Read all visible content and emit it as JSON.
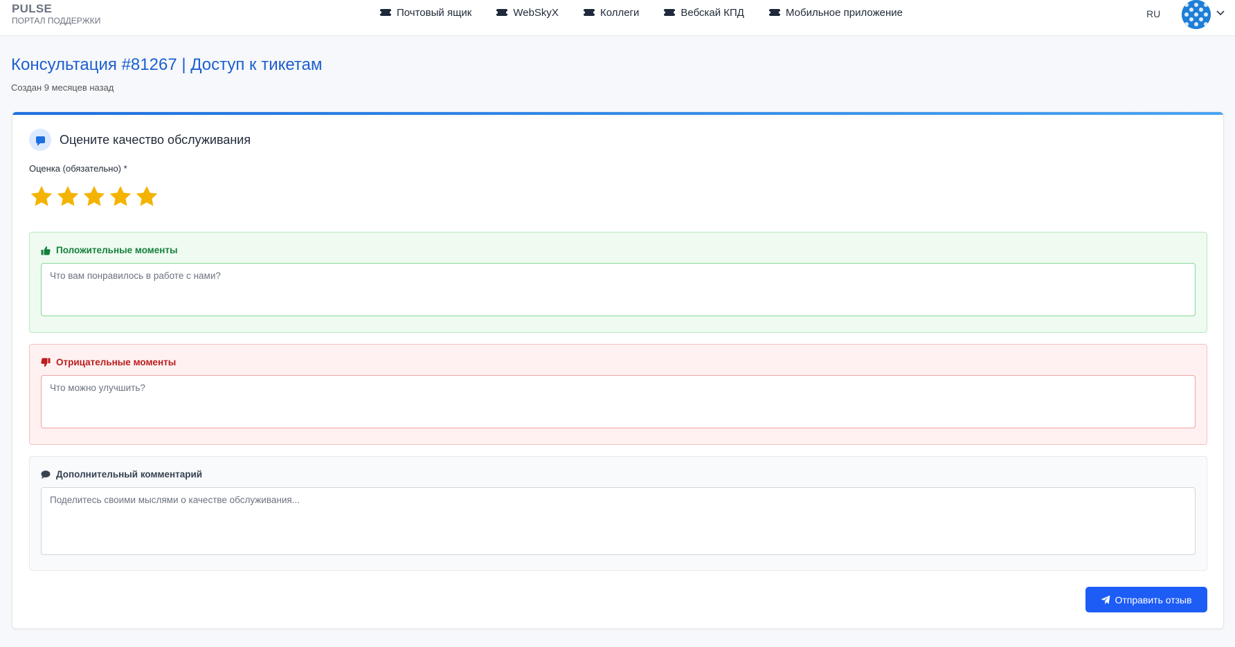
{
  "header": {
    "brand_name": "PULSE",
    "brand_sub": "ПОРТАЛ ПОДДЕРЖКИ",
    "nav": [
      {
        "label": "Почтовый ящик",
        "icon": "ticket-icon"
      },
      {
        "label": "WebSkyX",
        "icon": "ticket-icon"
      },
      {
        "label": "Коллеги",
        "icon": "ticket-icon"
      },
      {
        "label": "Вебскай КПД",
        "icon": "ticket-icon"
      },
      {
        "label": "Мобильное приложение",
        "icon": "ticket-icon"
      }
    ],
    "language": "RU",
    "avatar_icon": "avatar-pattern",
    "menu_icon": "chevron-down-icon"
  },
  "page": {
    "title": "Консультация #81267 | Доступ к тикетам",
    "subtitle": "Создан 9 месяцев назад"
  },
  "feedback": {
    "title": "Оцените качество обслуживания",
    "title_icon": "chat-bubble-icon",
    "rating_label": "Оценка (обязательно) *",
    "rating": {
      "value": 5,
      "max": 5
    },
    "positive": {
      "label": "Положительные моменты",
      "icon": "thumbs-up-icon",
      "placeholder": "Что вам понравилось в работе с нами?",
      "value": ""
    },
    "negative": {
      "label": "Отрицательные моменты",
      "icon": "thumbs-down-icon",
      "placeholder": "Что можно улучшить?",
      "value": ""
    },
    "comment": {
      "label": "Дополнительный комментарий",
      "icon": "comment-icon",
      "placeholder": "Поделитесь своими мыслями о качестве обслуживания...",
      "value": ""
    },
    "submit_label": "Отправить отзыв",
    "submit_icon": "paper-plane-icon"
  },
  "colors": {
    "accent": "#1d5cf5",
    "title": "#1d5fcf",
    "star": "#f5b301",
    "positive": "#15803d",
    "negative": "#b91c1c"
  }
}
